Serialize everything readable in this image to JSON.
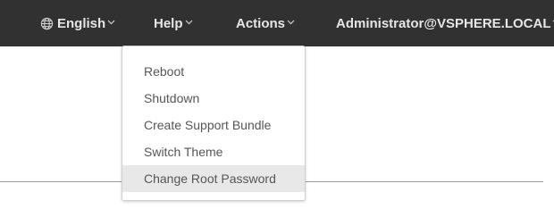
{
  "header": {
    "language_label": "English",
    "help_label": "Help",
    "actions_label": "Actions",
    "user_label": "Administrator@VSPHERE.LOCAL"
  },
  "icons": {
    "language": "globe-icon",
    "dropdown_indicator": "chevron-down-icon"
  },
  "colors": {
    "header_bg": "#313131",
    "header_text": "#e6e6e6",
    "menu_highlight": "#e8e8e8"
  },
  "actions_menu": {
    "items": [
      {
        "label": "Reboot"
      },
      {
        "label": "Shutdown"
      },
      {
        "label": "Create Support Bundle"
      },
      {
        "label": "Switch Theme"
      },
      {
        "label": "Change Root Password",
        "highlighted": true
      }
    ]
  }
}
